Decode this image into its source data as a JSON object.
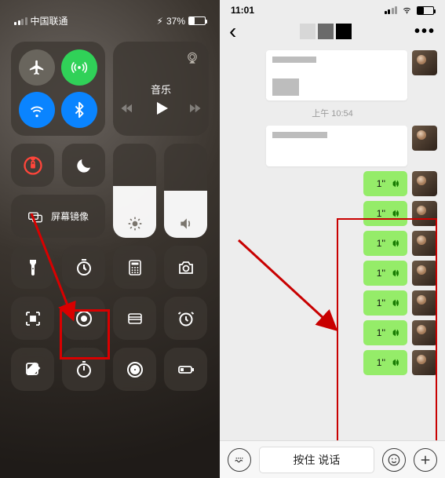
{
  "left": {
    "carrier": "中国联通",
    "battery_pct": "37%",
    "battery_icon_sym": "⚡︎",
    "music_label": "音乐",
    "screen_mirror_label": "屏幕镜像"
  },
  "right": {
    "time": "11:01",
    "nav_back": "‹",
    "nav_more": "•••",
    "timestamp": "上午 10:54",
    "voice_msgs": [
      {
        "dur": "1''"
      },
      {
        "dur": "1''"
      },
      {
        "dur": "1''"
      },
      {
        "dur": "1''"
      },
      {
        "dur": "1''"
      },
      {
        "dur": "1''"
      },
      {
        "dur": "1''"
      }
    ],
    "talk_label": "按住 说话"
  }
}
